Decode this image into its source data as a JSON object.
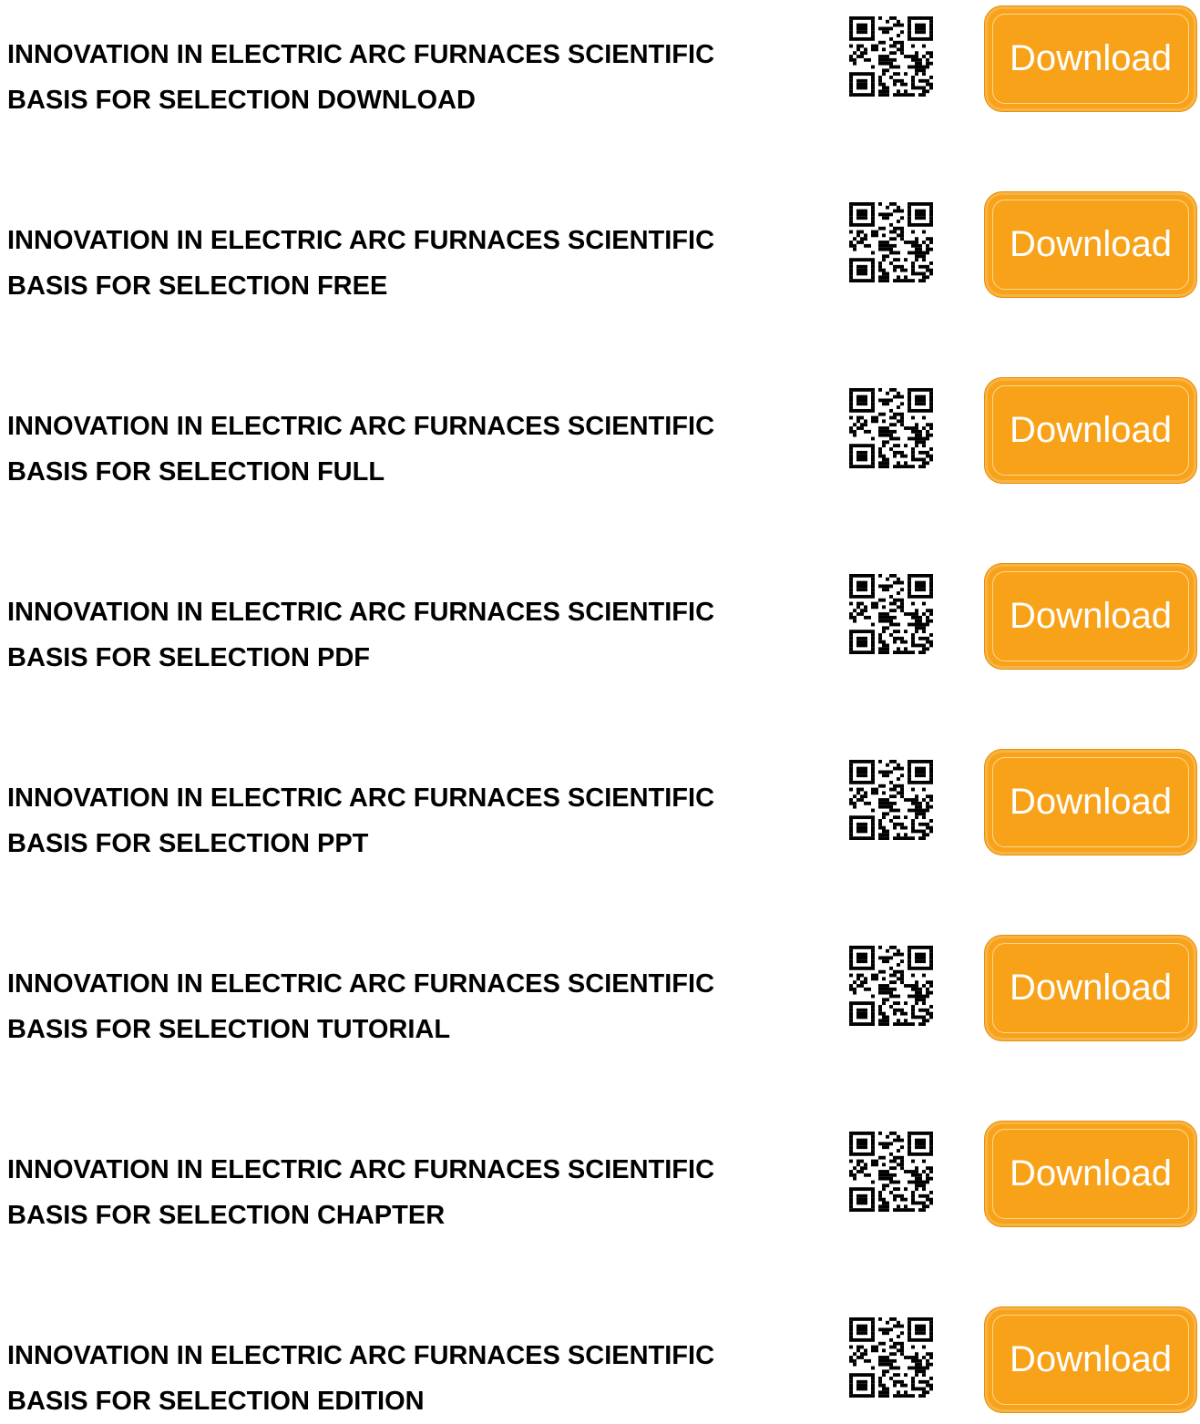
{
  "rows": [
    {
      "title_line1": "INNOVATION IN ELECTRIC ARC FURNACES SCIENTIFIC",
      "title_line2": "BASIS FOR SELECTION DOWNLOAD",
      "button_label": "Download",
      "qr_icon": "qr-code-icon"
    },
    {
      "title_line1": "INNOVATION IN ELECTRIC ARC FURNACES SCIENTIFIC",
      "title_line2": "BASIS FOR SELECTION FREE",
      "button_label": "Download",
      "qr_icon": "qr-code-icon"
    },
    {
      "title_line1": "INNOVATION IN ELECTRIC ARC FURNACES SCIENTIFIC",
      "title_line2": "BASIS FOR SELECTION FULL",
      "button_label": "Download",
      "qr_icon": "qr-code-icon"
    },
    {
      "title_line1": "INNOVATION IN ELECTRIC ARC FURNACES SCIENTIFIC",
      "title_line2": "BASIS FOR SELECTION PDF",
      "button_label": "Download",
      "qr_icon": "qr-code-icon"
    },
    {
      "title_line1": "INNOVATION IN ELECTRIC ARC FURNACES SCIENTIFIC",
      "title_line2": "BASIS FOR SELECTION PPT",
      "button_label": "Download",
      "qr_icon": "qr-code-icon"
    },
    {
      "title_line1": "INNOVATION IN ELECTRIC ARC FURNACES SCIENTIFIC",
      "title_line2": "BASIS FOR SELECTION TUTORIAL",
      "button_label": "Download",
      "qr_icon": "qr-code-icon"
    },
    {
      "title_line1": "INNOVATION IN ELECTRIC ARC FURNACES SCIENTIFIC",
      "title_line2": "BASIS FOR SELECTION CHAPTER",
      "button_label": "Download",
      "qr_icon": "qr-code-icon"
    },
    {
      "title_line1": "INNOVATION IN ELECTRIC ARC FURNACES SCIENTIFIC",
      "title_line2": "BASIS FOR SELECTION EDITION",
      "button_label": "Download",
      "qr_icon": "qr-code-icon"
    }
  ],
  "colors": {
    "button": "#f8a21a",
    "button_text": "#ffffff",
    "title_text": "#000000"
  }
}
